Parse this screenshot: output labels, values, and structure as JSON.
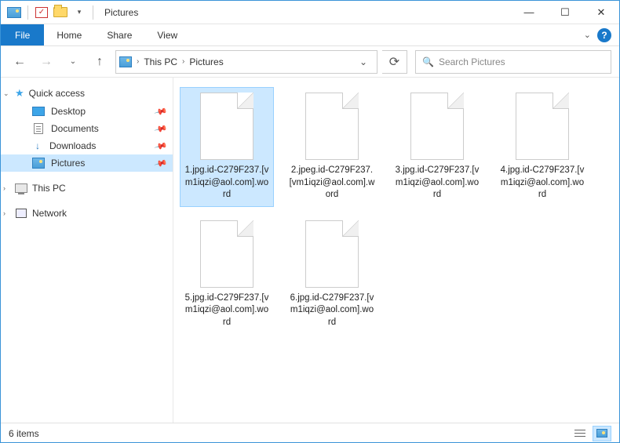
{
  "window": {
    "title": "Pictures"
  },
  "ribbon": {
    "file": "File",
    "tabs": [
      "Home",
      "Share",
      "View"
    ]
  },
  "breadcrumb": {
    "parts": [
      "This PC",
      "Pictures"
    ]
  },
  "search": {
    "placeholder": "Search Pictures"
  },
  "sidebar": {
    "quick_access": "Quick access",
    "items": [
      {
        "label": "Desktop",
        "icon": "desktop",
        "pinned": true
      },
      {
        "label": "Documents",
        "icon": "doc",
        "pinned": true
      },
      {
        "label": "Downloads",
        "icon": "down",
        "pinned": true
      },
      {
        "label": "Pictures",
        "icon": "pic",
        "pinned": true,
        "selected": true
      }
    ],
    "this_pc": "This PC",
    "network": "Network"
  },
  "files": [
    {
      "name": "1.jpg.id-C279F237.[vm1iqzi@aol.com].word",
      "selected": true
    },
    {
      "name": "2.jpeg.id-C279F237.[vm1iqzi@aol.com].word"
    },
    {
      "name": "3.jpg.id-C279F237.[vm1iqzi@aol.com].word"
    },
    {
      "name": "4.jpg.id-C279F237.[vm1iqzi@aol.com].word"
    },
    {
      "name": "5.jpg.id-C279F237.[vm1iqzi@aol.com].word"
    },
    {
      "name": "6.jpg.id-C279F237.[vm1iqzi@aol.com].word"
    }
  ],
  "status": {
    "count": "6 items"
  }
}
